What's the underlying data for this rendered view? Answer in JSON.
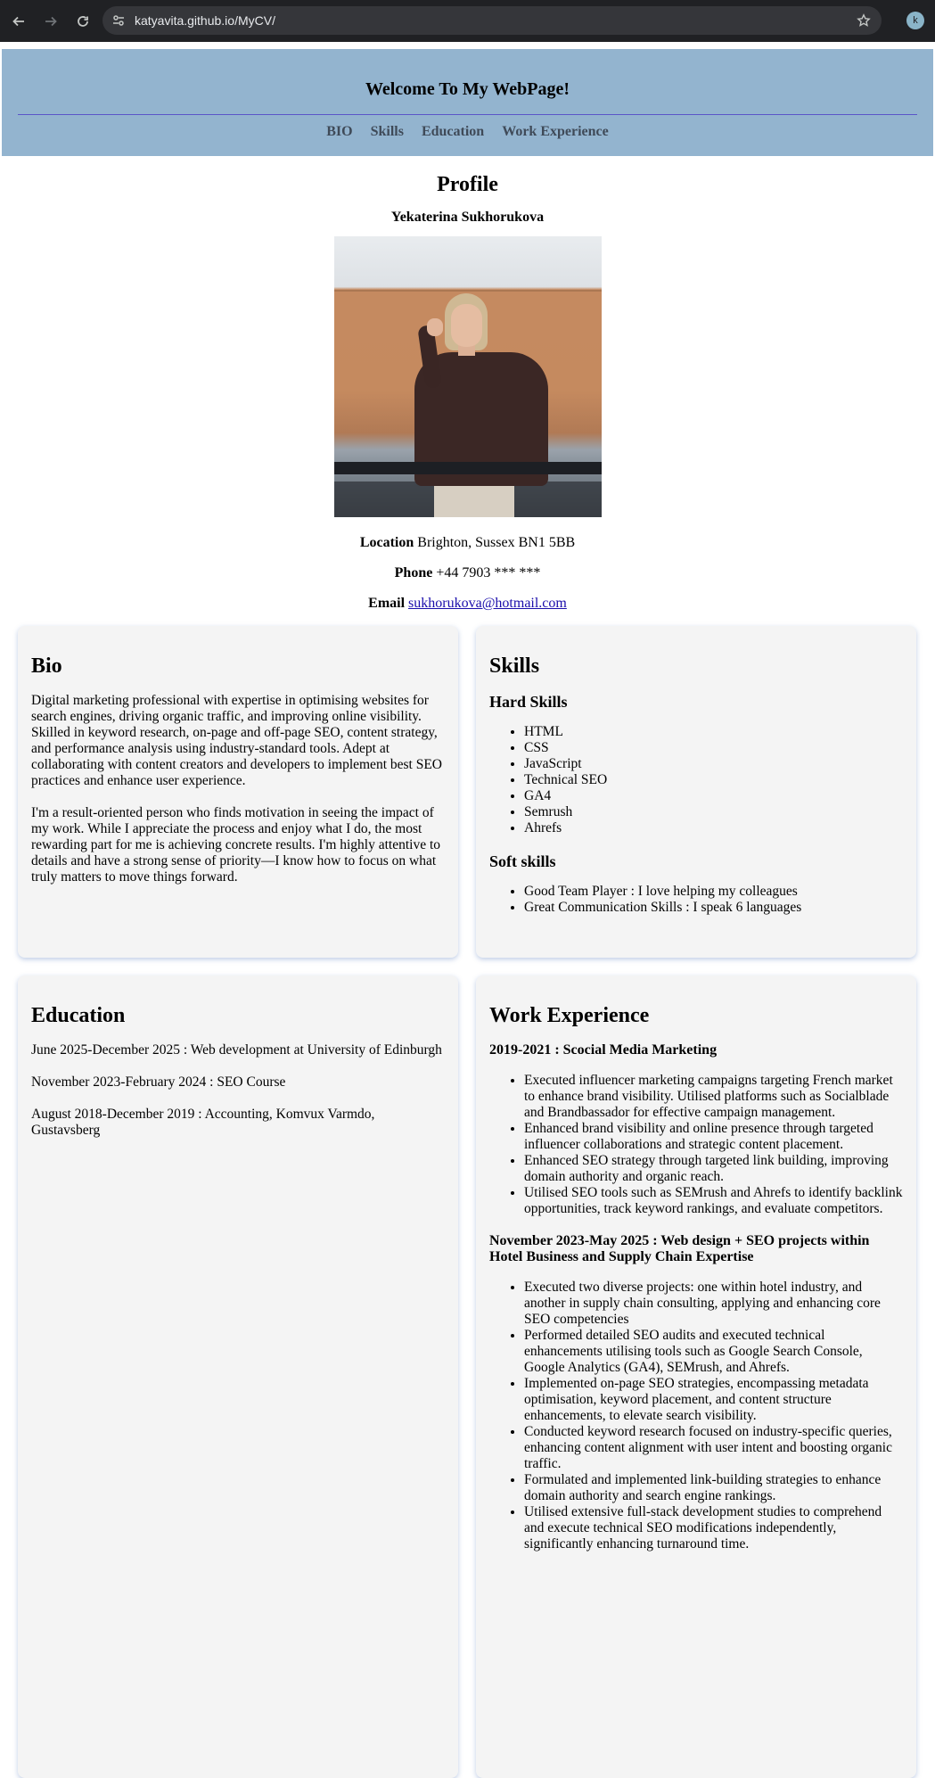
{
  "browser": {
    "url": "katyavita.github.io/MyCV/",
    "profile_initial": "k"
  },
  "header": {
    "title": "Welcome To My WebPage!",
    "nav": [
      "BIO",
      "Skills",
      "Education",
      "Work Experience"
    ]
  },
  "profile": {
    "heading": "Profile",
    "name": "Yekaterina Sukhorukova",
    "location_label": "Location",
    "location_value": "Brighton, Sussex BN1 5BB",
    "phone_label": "Phone",
    "phone_value": "+44 7903 *** ***",
    "email_label": "Email",
    "email_value": "sukhorukova@hotmail.com"
  },
  "bio": {
    "heading": "Bio",
    "paragraphs": [
      "Digital marketing professional with expertise in optimising websites for search engines, driving organic traffic, and improving online visibility. Skilled in keyword research, on-page and off-page SEO, content strategy, and performance analysis using industry-standard tools. Adept at collaborating with content creators and developers to implement best SEO practices and enhance user experience.",
      "I'm a result-oriented person who finds motivation in seeing the impact of my work. While I appreciate the process and enjoy what I do, the most rewarding part for me is achieving concrete results. I'm highly attentive to details and have a strong sense of priority—I know how to focus on what truly matters to move things forward."
    ]
  },
  "skills": {
    "heading": "Skills",
    "hard_heading": "Hard Skills",
    "hard": [
      "HTML",
      "CSS",
      "JavaScript",
      "Technical SEO",
      "GA4",
      "Semrush",
      "Ahrefs"
    ],
    "soft_heading": "Soft skills",
    "soft": [
      "Good Team Player : I love helping my colleagues",
      "Great Communication Skills : I speak 6 languages"
    ]
  },
  "education": {
    "heading": "Education",
    "items": [
      "June 2025-December 2025 : Web development at University of Edinburgh",
      "November 2023-February 2024 : SEO Course",
      "August 2018-December 2019 : Accounting, Komvux Varmdo, Gustavsberg"
    ]
  },
  "work": {
    "heading": "Work Experience",
    "jobs": [
      {
        "title": "2019-2021 : Scocial Media Marketing",
        "bullets": [
          "Executed influencer marketing campaigns targeting French market to enhance brand visibility. Utilised platforms such as Socialblade and Brandbassador for effective campaign management.",
          "Enhanced brand visibility and online presence through targeted influencer collaborations and strategic content placement.",
          "Enhanced SEO strategy through targeted link building, improving domain authority and organic reach.",
          "Utilised SEO tools such as SEMrush and Ahrefs to identify backlink opportunities, track keyword rankings, and evaluate competitors."
        ]
      },
      {
        "title": "November 2023-May 2025 : Web design + SEO projects within Hotel Business and Supply Chain Expertise",
        "bullets": [
          "Executed two diverse projects: one within hotel industry, and another in supply chain consulting, applying and enhancing core SEO competencies",
          "Performed detailed SEO audits and executed technical enhancements utilising tools such as Google Search Console, Google Analytics (GA4), SEMrush, and Ahrefs.",
          "Implemented on-page SEO strategies, encompassing metadata optimisation, keyword placement, and content structure enhancements, to elevate search visibility.",
          "Conducted keyword research focused on industry-specific queries, enhancing content alignment with user intent and boosting organic traffic.",
          "Formulated and implemented link-building strategies to enhance domain authority and search engine rankings.",
          "Utilised extensive full-stack development studies to comprehend and execute technical SEO modifications independently, significantly enhancing turnaround time."
        ]
      }
    ]
  }
}
